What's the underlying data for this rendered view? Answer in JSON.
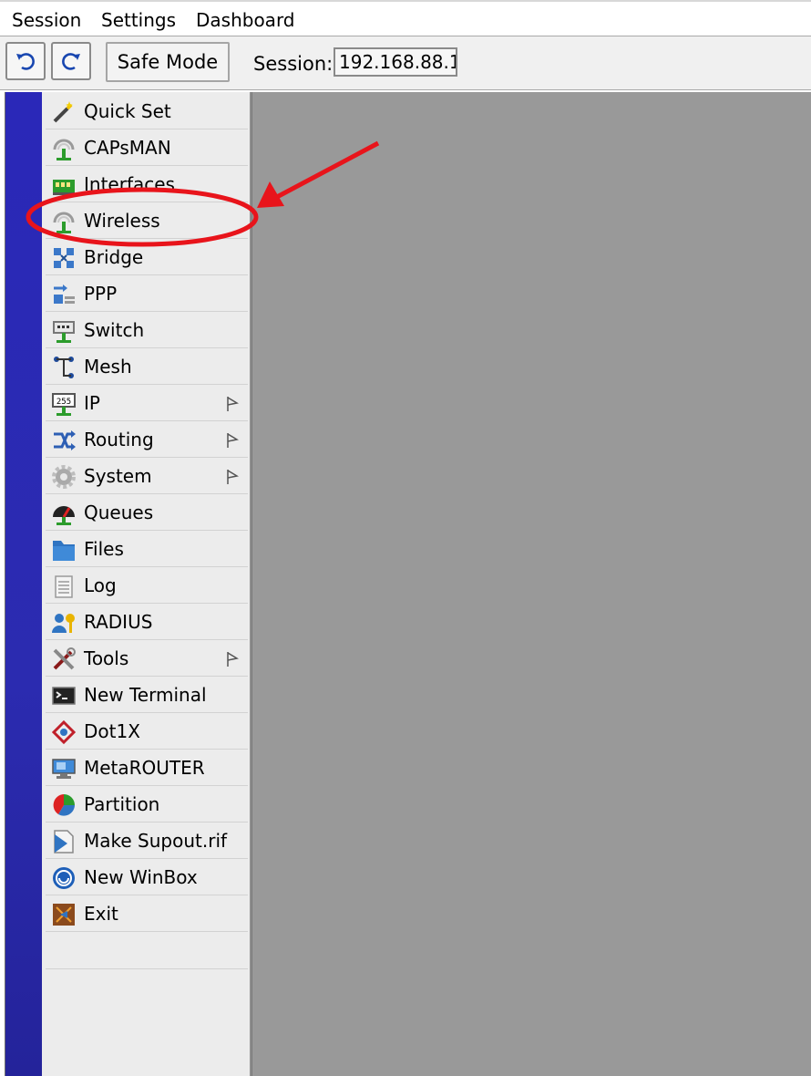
{
  "menubar": {
    "items": [
      "Session",
      "Settings",
      "Dashboard"
    ]
  },
  "toolbar": {
    "undo_icon": "undo-icon",
    "redo_icon": "redo-icon",
    "safe_mode_label": "Safe Mode",
    "session_label": "Session:",
    "session_value": "192.168.88.1"
  },
  "menu": {
    "items": [
      {
        "label": "Quick Set",
        "icon": "wand-icon",
        "submenu": false
      },
      {
        "label": "CAPsMAN",
        "icon": "antenna-icon",
        "submenu": false
      },
      {
        "label": "Interfaces",
        "icon": "network-card-icon",
        "submenu": false
      },
      {
        "label": "Wireless",
        "icon": "antenna-icon",
        "submenu": false
      },
      {
        "label": "Bridge",
        "icon": "bridge-icon",
        "submenu": false
      },
      {
        "label": "PPP",
        "icon": "ppp-icon",
        "submenu": false
      },
      {
        "label": "Switch",
        "icon": "switch-icon",
        "submenu": false
      },
      {
        "label": "Mesh",
        "icon": "mesh-icon",
        "submenu": false
      },
      {
        "label": "IP",
        "icon": "ip-icon",
        "submenu": true
      },
      {
        "label": "Routing",
        "icon": "routing-icon",
        "submenu": true
      },
      {
        "label": "System",
        "icon": "gear-icon",
        "submenu": true
      },
      {
        "label": "Queues",
        "icon": "gauge-icon",
        "submenu": false
      },
      {
        "label": "Files",
        "icon": "folder-icon",
        "submenu": false
      },
      {
        "label": "Log",
        "icon": "notepad-icon",
        "submenu": false
      },
      {
        "label": "RADIUS",
        "icon": "user-key-icon",
        "submenu": false
      },
      {
        "label": "Tools",
        "icon": "tools-icon",
        "submenu": true
      },
      {
        "label": "New Terminal",
        "icon": "terminal-icon",
        "submenu": false
      },
      {
        "label": "Dot1X",
        "icon": "dot1x-icon",
        "submenu": false
      },
      {
        "label": "MetaROUTER",
        "icon": "monitor-icon",
        "submenu": false
      },
      {
        "label": "Partition",
        "icon": "pie-icon",
        "submenu": false
      },
      {
        "label": "Make Supout.rif",
        "icon": "document-icon",
        "submenu": false
      },
      {
        "label": "New WinBox",
        "icon": "winbox-icon",
        "submenu": false
      },
      {
        "label": "Exit",
        "icon": "exit-icon",
        "submenu": false
      }
    ]
  },
  "annotation": {
    "highlighted_item": "Wireless",
    "color": "#e8141b"
  },
  "colors": {
    "rail": "#2b2bb0",
    "workspace": "#999999",
    "panel": "#ececec"
  }
}
